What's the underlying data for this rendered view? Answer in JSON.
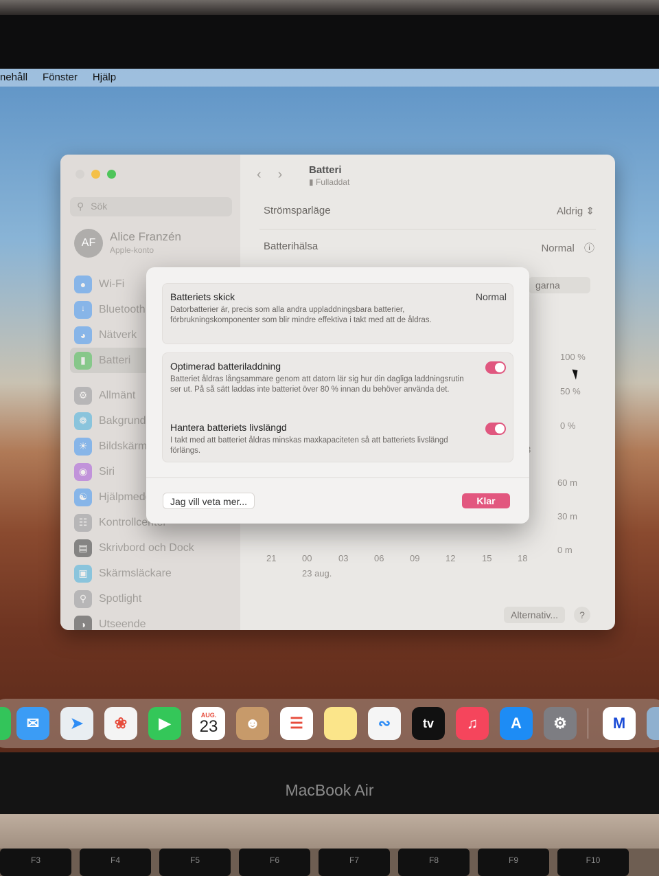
{
  "device": {
    "brand_label": "MacBook Air"
  },
  "menubar": {
    "items": [
      "nehåll",
      "Fönster",
      "Hjälp"
    ]
  },
  "sidebar": {
    "search_placeholder": "Sök",
    "user": {
      "initials": "AF",
      "name": "Alice Franzén",
      "subtitle": "Apple-konto"
    },
    "items": [
      {
        "label": "Wi-Fi",
        "icon": "wifi-icon",
        "color": "#2f8df5"
      },
      {
        "label": "Bluetooth",
        "icon": "bluetooth-icon",
        "color": "#2f8df5"
      },
      {
        "label": "Nätverk",
        "icon": "globe-icon",
        "color": "#2f8df5"
      },
      {
        "label": "Batteri",
        "icon": "battery-icon",
        "color": "#3cbf4a",
        "selected": true
      },
      {
        "label": "Allmänt",
        "icon": "gear-icon",
        "color": "#8e8e93"
      },
      {
        "label": "Bakgrundsbild",
        "icon": "wallpaper-icon",
        "color": "#35aadc"
      },
      {
        "label": "Bildskärmar",
        "icon": "sun-icon",
        "color": "#2f8df5"
      },
      {
        "label": "Siri",
        "icon": "siri-icon",
        "color": "#a24ad8"
      },
      {
        "label": "Hjälpmedel",
        "icon": "accessibility-icon",
        "color": "#2f8df5"
      },
      {
        "label": "Kontrollcenter",
        "icon": "control-center-icon",
        "color": "#8e8e93"
      },
      {
        "label": "Skrivbord och Dock",
        "icon": "dock-icon",
        "color": "#2c2c2e"
      },
      {
        "label": "Skärmsläckare",
        "icon": "screensaver-icon",
        "color": "#35aadc"
      },
      {
        "label": "Spotlight",
        "icon": "search-icon",
        "color": "#8e8e93"
      },
      {
        "label": "Utseende",
        "icon": "appearance-icon",
        "color": "#2c2c2e"
      }
    ]
  },
  "content": {
    "title": "Batteri",
    "subtitle": "Fulladdat",
    "rows": [
      {
        "label": "Strömsparläge",
        "value": "Aldrig"
      },
      {
        "label": "Batterihälsa",
        "value": "Normal"
      }
    ],
    "partial_button": "garna",
    "chart_y_labels_top": [
      "100 %",
      "50 %",
      "0 %"
    ],
    "chart_y_labels_bottom": [
      "60 m",
      "30 m",
      "0 m"
    ],
    "chart_partial_tick": "3",
    "chart_x_labels": [
      "21",
      "00",
      "03",
      "06",
      "09",
      "12",
      "15",
      "18"
    ],
    "chart_date": "23 aug.",
    "options_button": "Alternativ...",
    "help_button": "?"
  },
  "sheet": {
    "condition": {
      "title": "Batteriets skick",
      "value": "Normal",
      "description": "Datorbatterier är, precis som alla andra uppladdningsbara batterier, förbrukningskomponenter som blir mindre effektiva i takt med att de åldras."
    },
    "optimized": {
      "title": "Optimerad batteriladdning",
      "description": "Batteriet åldras långsammare genom att datorn lär sig hur din dagliga laddningsrutin ser ut. På så sätt laddas inte batteriet över 80 % innan du behöver använda det.",
      "enabled": true
    },
    "lifespan": {
      "title": "Hantera batteriets livslängd",
      "description": "I takt med att batteriet åldras minskas maxkapaciteten så att batteriets livslängd förlängs.",
      "enabled": true
    },
    "learn_more_button": "Jag vill veta mer...",
    "done_button": "Klar",
    "accent_color": "#e2577f"
  },
  "dock": {
    "calendar_month": "AUG.",
    "calendar_day": "23",
    "tv_label": "tv",
    "apps": [
      "messages-icon",
      "mail-icon",
      "maps-icon",
      "photos-icon",
      "facetime-icon",
      "calendar-icon",
      "contacts-icon",
      "reminders-icon",
      "notes-icon",
      "freeform-icon",
      "apple-tv-icon",
      "music-icon",
      "app-store-icon",
      "system-settings-icon",
      "malwarebytes-icon",
      "preview-icon"
    ]
  },
  "keyboard": {
    "keys": [
      "F3",
      "F4",
      "F5",
      "F6",
      "F7",
      "F8",
      "F9",
      "F10"
    ]
  }
}
